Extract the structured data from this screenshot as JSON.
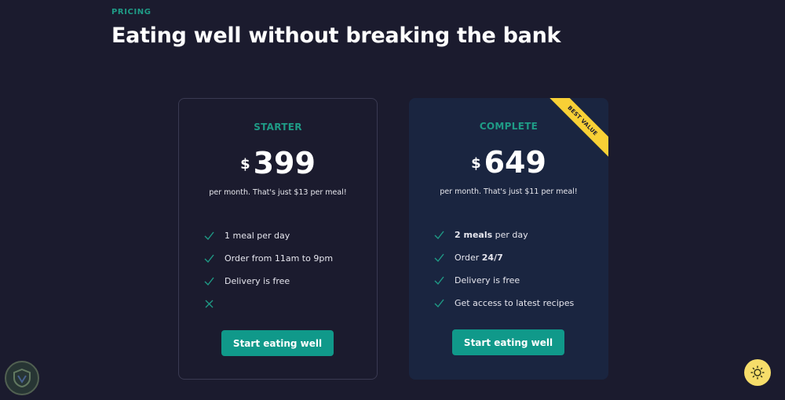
{
  "header": {
    "eyebrow": "PRICING",
    "title": "Eating well without breaking the bank"
  },
  "plans": [
    {
      "name": "STARTER",
      "currency": "$",
      "price": "399",
      "note": "per month. That's just $13 per meal!",
      "features": [
        {
          "icon": "check-icon",
          "pre": "1 meal per day",
          "bold": "",
          "post": ""
        },
        {
          "icon": "check-icon",
          "pre": "Order from 11am to 9pm",
          "bold": "",
          "post": ""
        },
        {
          "icon": "check-icon",
          "pre": "Delivery is free",
          "bold": "",
          "post": ""
        },
        {
          "icon": "x-icon",
          "pre": "",
          "bold": "",
          "post": ""
        }
      ],
      "cta": "Start eating well"
    },
    {
      "name": "COMPLETE",
      "currency": "$",
      "price": "649",
      "note": "per month. That's just $11 per meal!",
      "ribbon": "BEST VALUE",
      "features": [
        {
          "icon": "check-icon",
          "pre": "",
          "bold": "2 meals",
          "post": " per day"
        },
        {
          "icon": "check-icon",
          "pre": "Order ",
          "bold": "24/7",
          "post": ""
        },
        {
          "icon": "check-icon",
          "pre": "Delivery is free",
          "bold": "",
          "post": ""
        },
        {
          "icon": "check-icon",
          "pre": "Get access to latest recipes",
          "bold": "",
          "post": ""
        }
      ],
      "cta": "Start eating well"
    }
  ],
  "colors": {
    "background": "#1b1b2e",
    "accent": "#10998a",
    "ribbon": "#f8d036",
    "complete_card": "#1a2540"
  },
  "icons": {
    "fab": "sun-icon",
    "corner_badge": "shield-icon"
  }
}
